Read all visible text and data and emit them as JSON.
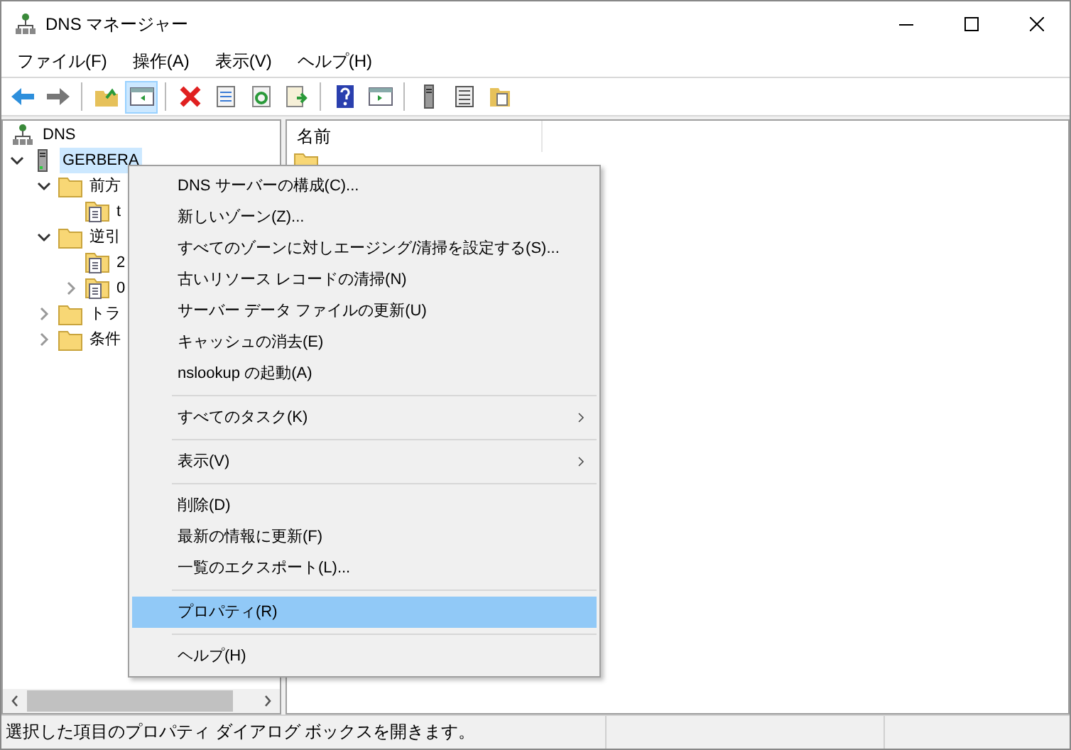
{
  "window": {
    "title": "DNS マネージャー"
  },
  "menu_bar": [
    "ファイル(F)",
    "操作(A)",
    "表示(V)",
    "ヘルプ(H)"
  ],
  "toolbar": [
    {
      "kind": "back",
      "pressed": false
    },
    {
      "kind": "forward",
      "pressed": false
    },
    {
      "kind": "sep"
    },
    {
      "kind": "up",
      "pressed": false
    },
    {
      "kind": "tree",
      "pressed": true
    },
    {
      "kind": "sep"
    },
    {
      "kind": "delete",
      "pressed": false
    },
    {
      "kind": "props",
      "pressed": false
    },
    {
      "kind": "refresh",
      "pressed": false
    },
    {
      "kind": "export",
      "pressed": false
    },
    {
      "kind": "sep"
    },
    {
      "kind": "help",
      "pressed": false
    },
    {
      "kind": "pane",
      "pressed": false
    },
    {
      "kind": "sep"
    },
    {
      "kind": "server",
      "pressed": false
    },
    {
      "kind": "list",
      "pressed": false
    },
    {
      "kind": "folders",
      "pressed": false
    }
  ],
  "tree": [
    {
      "label": "DNS",
      "kind": "root",
      "has_toggle": false,
      "expanded": true,
      "selected": false,
      "children": [
        {
          "label": "GERBERA",
          "kind": "server",
          "has_toggle": true,
          "expanded": true,
          "selected": true,
          "children": [
            {
              "label": "前方",
              "kind": "folder",
              "has_toggle": true,
              "expanded": true,
              "selected": false,
              "children": [
                {
                  "label": "t",
                  "kind": "zone",
                  "has_toggle": false,
                  "selected": false
                }
              ]
            },
            {
              "label": "逆引",
              "kind": "folder",
              "has_toggle": true,
              "expanded": true,
              "selected": false,
              "children": [
                {
                  "label": "2",
                  "kind": "zone",
                  "has_toggle": false,
                  "selected": false
                },
                {
                  "label": "0",
                  "kind": "zone",
                  "has_toggle": true,
                  "expanded": false,
                  "selected": false
                }
              ]
            },
            {
              "label": "トラ",
              "kind": "folder",
              "has_toggle": true,
              "expanded": false,
              "selected": false
            },
            {
              "label": "条件",
              "kind": "folder",
              "has_toggle": true,
              "expanded": false,
              "selected": false
            }
          ]
        }
      ]
    }
  ],
  "list": {
    "columns": [
      "名前"
    ]
  },
  "context_menu": [
    {
      "kind": "item",
      "label": "DNS サーバーの構成(C)...",
      "submenu": false,
      "selected": false
    },
    {
      "kind": "item",
      "label": "新しいゾーン(Z)...",
      "submenu": false,
      "selected": false
    },
    {
      "kind": "item",
      "label": "すべてのゾーンに対しエージング/清掃を設定する(S)...",
      "submenu": false,
      "selected": false
    },
    {
      "kind": "item",
      "label": "古いリソース レコードの清掃(N)",
      "submenu": false,
      "selected": false
    },
    {
      "kind": "item",
      "label": "サーバー データ ファイルの更新(U)",
      "submenu": false,
      "selected": false
    },
    {
      "kind": "item",
      "label": "キャッシュの消去(E)",
      "submenu": false,
      "selected": false
    },
    {
      "kind": "item",
      "label": "nslookup の起動(A)",
      "submenu": false,
      "selected": false
    },
    {
      "kind": "separator"
    },
    {
      "kind": "item",
      "label": "すべてのタスク(K)",
      "submenu": true,
      "selected": false
    },
    {
      "kind": "separator"
    },
    {
      "kind": "item",
      "label": "表示(V)",
      "submenu": true,
      "selected": false
    },
    {
      "kind": "separator"
    },
    {
      "kind": "item",
      "label": "削除(D)",
      "submenu": false,
      "selected": false
    },
    {
      "kind": "item",
      "label": "最新の情報に更新(F)",
      "submenu": false,
      "selected": false
    },
    {
      "kind": "item",
      "label": "一覧のエクスポート(L)...",
      "submenu": false,
      "selected": false
    },
    {
      "kind": "separator"
    },
    {
      "kind": "item",
      "label": "プロパティ(R)",
      "submenu": false,
      "selected": true
    },
    {
      "kind": "separator"
    },
    {
      "kind": "item",
      "label": "ヘルプ(H)",
      "submenu": false,
      "selected": false
    }
  ],
  "status_bar": {
    "text": "選択した項目のプロパティ ダイアログ ボックスを開きます。"
  }
}
